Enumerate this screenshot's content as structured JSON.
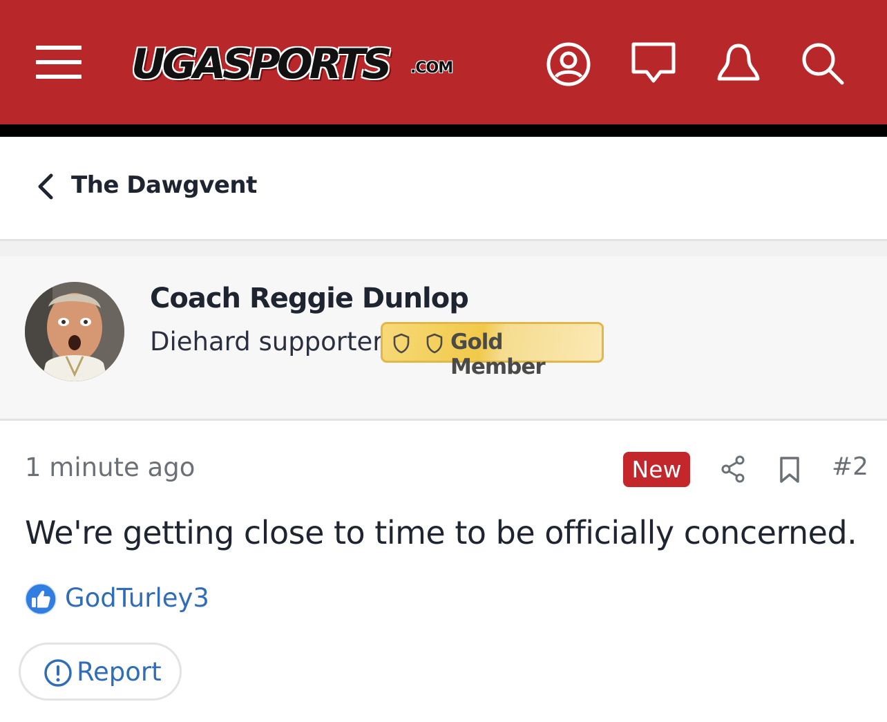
{
  "header": {
    "logo_main": "UGASPORTS",
    "logo_suffix": ".COM",
    "icons": [
      "menu-icon",
      "account-icon",
      "chat-icon",
      "notifications-icon",
      "search-icon"
    ],
    "colors": {
      "brand_red": "#b8272a",
      "rule": "#000000"
    }
  },
  "breadcrumb": {
    "title": "The Dawgvent"
  },
  "post": {
    "author": {
      "name": "Coach Reggie Dunlop",
      "role": "Diehard supporter",
      "badge": "Gold Member"
    },
    "time": "1 minute ago",
    "new_label": "New",
    "number": "#2",
    "body": "We're getting close to time to be officially concerned.",
    "reaction_user": "GodTurley3",
    "report_label": "Report"
  },
  "colors": {
    "new_badge": "#c3262b",
    "link": "#2f6db8",
    "gold_badge": "#f1c94a"
  }
}
